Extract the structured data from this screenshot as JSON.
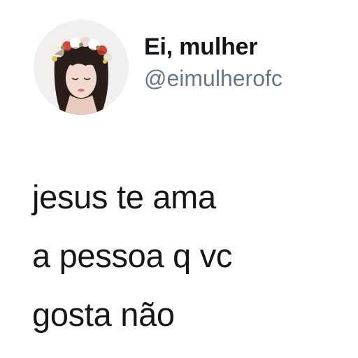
{
  "author": {
    "display_name": "Ei, mulher",
    "handle": "@eimulherofc",
    "avatar_icon": "profile-photo-flower-crown"
  },
  "tweet": {
    "lines": [
      "jesus te ama",
      "a pessoa q vc",
      "gosta não"
    ]
  },
  "colors": {
    "text": "#14171a",
    "handle": "#657786",
    "background": "#ffffff"
  }
}
